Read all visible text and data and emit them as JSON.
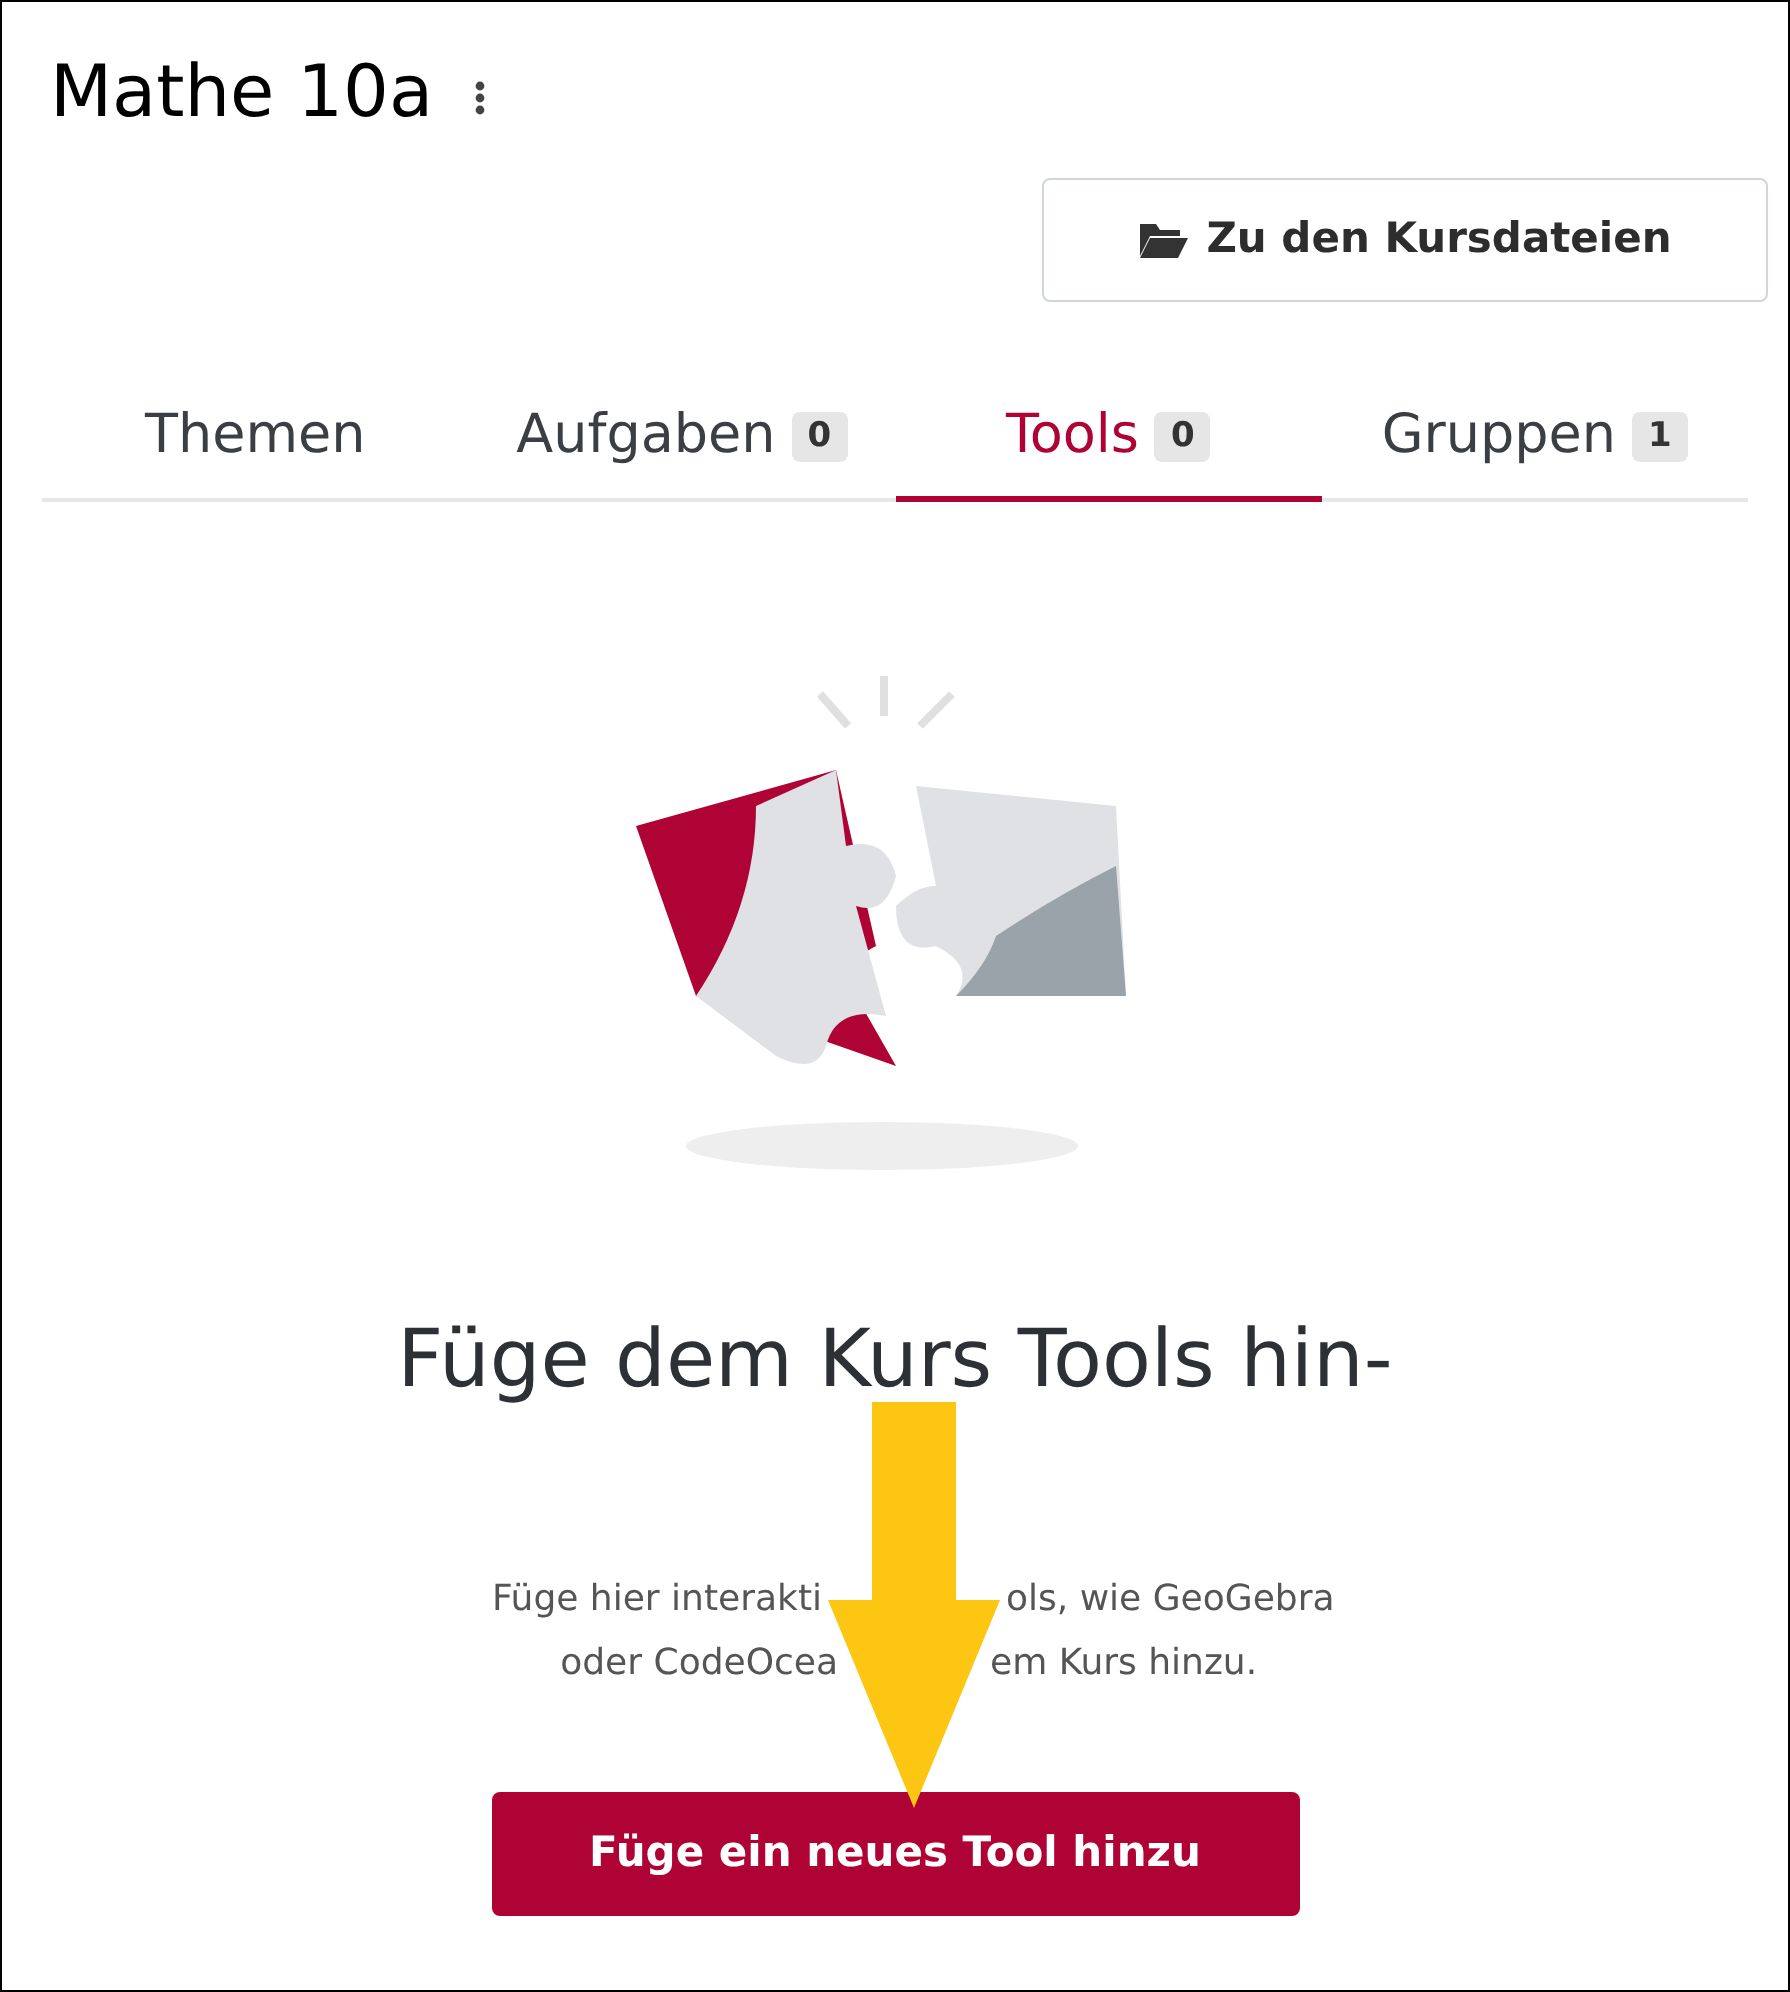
{
  "course": {
    "title": "Mathe 10a",
    "files_button": "Zu den Kursdateien"
  },
  "tabs": [
    {
      "label": "Themen",
      "selected": false
    },
    {
      "label": "Aufgaben",
      "count": "0",
      "selected": false
    },
    {
      "label": "Tools",
      "count": "0",
      "selected": true
    },
    {
      "label": "Gruppen",
      "count": "1",
      "selected": false
    }
  ],
  "empty_state": {
    "heading": "Füge dem Kurs Tools hin-",
    "text_lines": [
      {
        "left": "Füge hier interakti",
        "right": "ols, wie GeoGebra"
      },
      {
        "left": "oder CodeOcea",
        "right": "em Kurs hinzu."
      }
    ],
    "button": "Füge ein neues Tool hinzu"
  }
}
